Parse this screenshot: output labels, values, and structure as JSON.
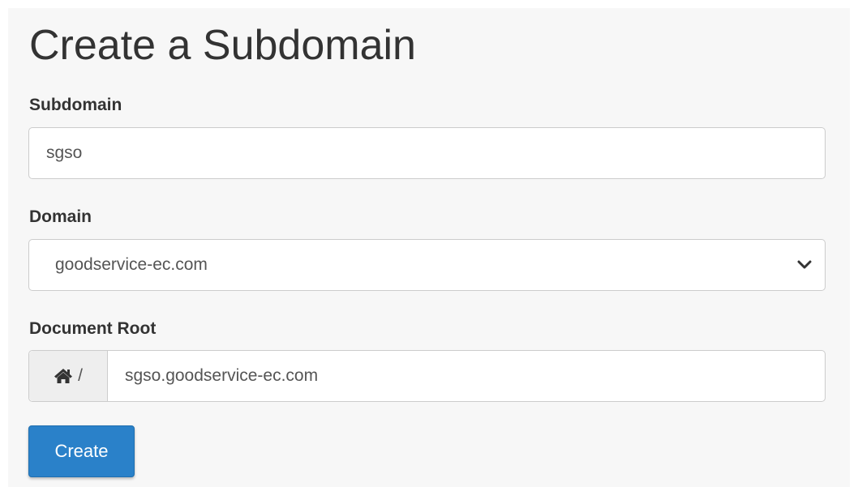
{
  "form": {
    "title": "Create a Subdomain",
    "subdomain": {
      "label": "Subdomain",
      "value": "sgso"
    },
    "domain": {
      "label": "Domain",
      "selected": "goodservice-ec.com"
    },
    "document_root": {
      "label": "Document Root",
      "prefix": "/",
      "value": "sgso.goodservice-ec.com"
    },
    "submit_label": "Create"
  },
  "colors": {
    "primary_button": "#2a81c9",
    "background": "#f7f7f7"
  },
  "icons": {
    "document_root_prefix": "home-icon",
    "domain_select": "chevron-down-icon"
  }
}
